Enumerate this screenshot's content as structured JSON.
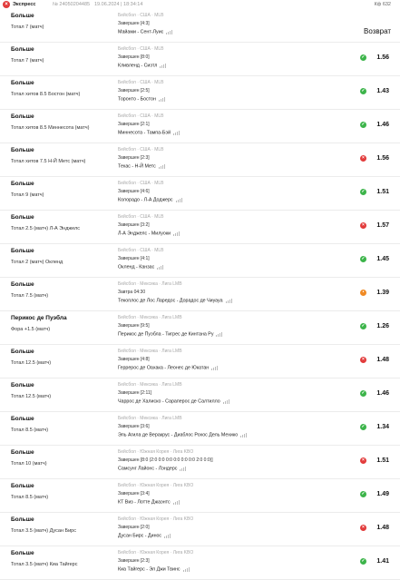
{
  "header": {
    "type_label": "Экспресс",
    "bet_number": "№ 24050204485",
    "datetime": "19.06.2024 | 18:34:14",
    "coef": "Кф 632"
  },
  "rows": [
    {
      "bet_type": "Больше",
      "desc": "Тотал 7 (матч)",
      "crumbs": "Бейсбол · США · MLB",
      "status": "Завершен [4:3]",
      "match": "Майами - Сент-Луис",
      "result": "refund",
      "odd": "Возврат"
    },
    {
      "bet_type": "Больше",
      "desc": "Тотал 7 (матч)",
      "crumbs": "Бейсбол · США · MLB",
      "status": "Завершен [8:0]",
      "match": "Кливленд - Сиэтл",
      "result": "win",
      "odd": "1.56"
    },
    {
      "bet_type": "Больше",
      "desc": "Тотал хитов 8.5 Бостон (матч)",
      "crumbs": "Бейсбол · США · MLB",
      "status": "Завершен [2:5]",
      "match": "Торонто - Бостон",
      "result": "win",
      "odd": "1.43"
    },
    {
      "bet_type": "Больше",
      "desc": "Тотал хитов 8.5 Миннесота (матч)",
      "crumbs": "Бейсбол · США · MLB",
      "status": "Завершен [2:1]",
      "match": "Миннесота - Тампа-Бэй",
      "result": "win",
      "odd": "1.46"
    },
    {
      "bet_type": "Больше",
      "desc": "Тотал хитов 7.5 Н-Й Метс (матч)",
      "crumbs": "Бейсбол · США · MLB",
      "status": "Завершен [2:3]",
      "match": "Техас - Н-Й Метс",
      "result": "lose",
      "odd": "1.56"
    },
    {
      "bet_type": "Больше",
      "desc": "Тотал 9 (матч)",
      "crumbs": "Бейсбол · США · MLB",
      "status": "Завершен [4:6]",
      "match": "Колорадо - Л-А Доджерс",
      "result": "win",
      "odd": "1.51"
    },
    {
      "bet_type": "Больше",
      "desc": "Тотал 2.5 (матч) Л-А Энджелс",
      "crumbs": "Бейсбол · США · MLB",
      "status": "Завершен [3:2]",
      "match": "Л-А Энджелс - Милуоки",
      "result": "lose",
      "odd": "1.57"
    },
    {
      "bet_type": "Больше",
      "desc": "Тотал 2 (матч) Окленд",
      "crumbs": "Бейсбол · США · MLB",
      "status": "Завершен [4:1]",
      "match": "Окленд - Канзас",
      "result": "win",
      "odd": "1.45"
    },
    {
      "bet_type": "Больше",
      "desc": "Тотал 7.5 (матч)",
      "crumbs": "Бейсбол · Мексика · Лига LMB",
      "status": "Завтра 04:30",
      "match": "Текоплос де Лос Ларедос - Дорадос де Чиуауа",
      "result": "pending",
      "odd": "1.39"
    },
    {
      "bet_type": "Перикос де Пуэбла",
      "desc": "Фора +1.5 (матч)",
      "crumbs": "Бейсбол · Мексика · Лига LMB",
      "status": "Завершен [9:5]",
      "match": "Перикос де Пуэбла - Тигрес де Кинтана Ру",
      "result": "win",
      "odd": "1.26"
    },
    {
      "bet_type": "Больше",
      "desc": "Тотал 12.5 (матч)",
      "crumbs": "Бейсбол · Мексика · Лига LMB",
      "status": "Завершен [4:8]",
      "match": "Геррерос де Оахака - Леонес де Юкатан",
      "result": "lose",
      "odd": "1.48"
    },
    {
      "bet_type": "Больше",
      "desc": "Тотал 12.5 (матч)",
      "crumbs": "Бейсбол · Мексика · Лига LMB",
      "status": "Завершен [2:11]",
      "match": "Чаррос де Халиско - Сараперос де Салтилло",
      "result": "win",
      "odd": "1.46"
    },
    {
      "bet_type": "Больше",
      "desc": "Тотал 8.5 (матч)",
      "crumbs": "Бейсбол · Мексика · Лига LMB",
      "status": "Завершен [3:6]",
      "match": "Эль Агила де Веракрус - Диаблос Рохос Дель Мехико",
      "result": "win",
      "odd": "1.34"
    },
    {
      "bet_type": "Больше",
      "desc": "Тотал 10 (матч)",
      "crumbs": "Бейсбол · Южная Корея · Лига KBO",
      "status": "Завершен [8:0 (2:0 0:0 0:0 0:0 0:0 0:0 2:0 0:0)]",
      "match": "Самсунг Лайонс - Лэндерс",
      "result": "lose",
      "odd": "1.51"
    },
    {
      "bet_type": "Больше",
      "desc": "Тотал 8.5 (матч)",
      "crumbs": "Бейсбол · Южная Корея · Лига KBO",
      "status": "Завершен [3:4]",
      "match": "КТ Виз - Лотте Джаэнтс",
      "result": "win",
      "odd": "1.49"
    },
    {
      "bet_type": "Больше",
      "desc": "Тотал 3.5 (матч) Дусан Бирс",
      "crumbs": "Бейсбол · Южная Корея · Лига KBO",
      "status": "Завершен [2:0]",
      "match": "Дусан Бирс - Динос",
      "result": "lose",
      "odd": "1.48"
    },
    {
      "bet_type": "Больше",
      "desc": "Тотал 3.5 (матч) Киа Тайгерс",
      "crumbs": "Бейсбол · Южная Корея · Лига KBO",
      "status": "Завершен [2:3]",
      "match": "Киа Тайгерс - Эл Джи Твинс",
      "result": "win",
      "odd": "1.41"
    }
  ]
}
